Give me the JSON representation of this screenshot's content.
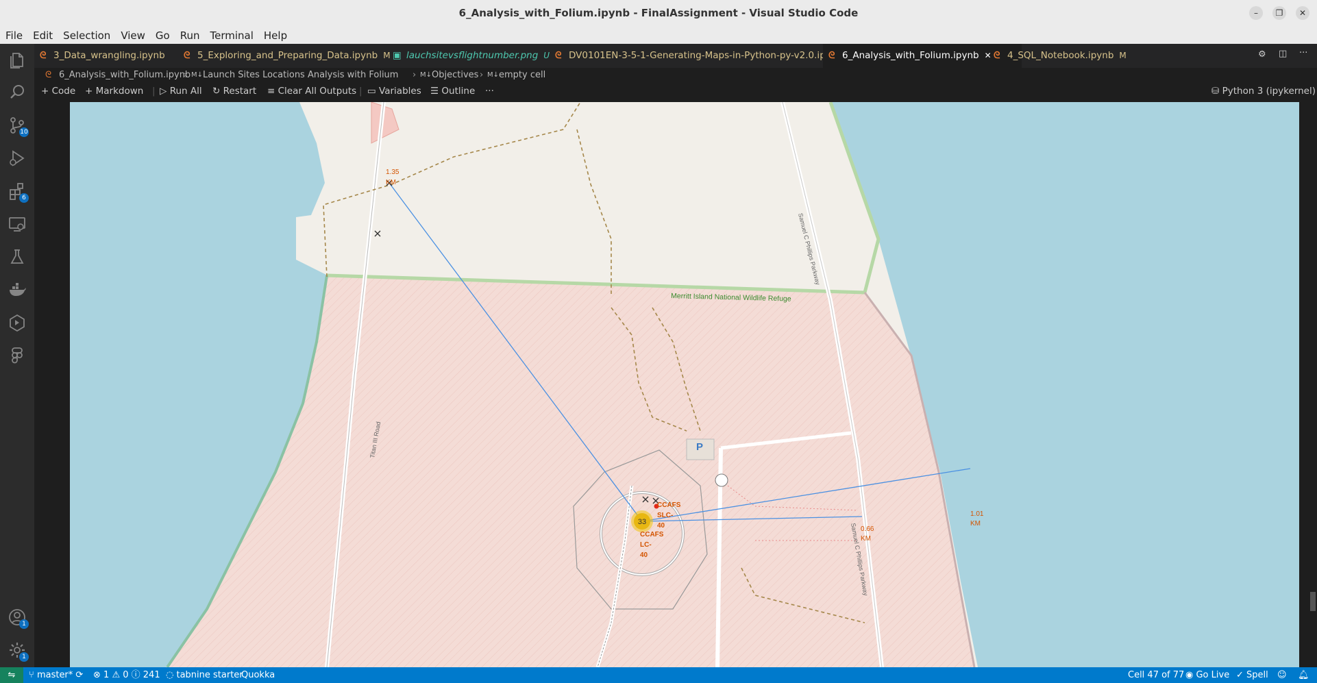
{
  "window": {
    "title": "6_Analysis_with_Folium.ipynb - FinalAssignment - Visual Studio Code",
    "minimize": "–",
    "restore": "❐",
    "close": "✕"
  },
  "menu": [
    "File",
    "Edit",
    "Selection",
    "View",
    "Go",
    "Run",
    "Terminal",
    "Help"
  ],
  "activity": {
    "scm_badge": "10",
    "extensions_badge": "6",
    "accounts_badge": "1",
    "settings_badge": "1"
  },
  "tabs": [
    {
      "label": "3_Data_wrangling.ipynb",
      "modified": ""
    },
    {
      "label": "5_Exploring_and_Preparing_Data.ipynb",
      "modified": "M"
    },
    {
      "label": "lauchsitevsflightnumber.png",
      "modified": "U"
    },
    {
      "label": "DV0101EN-3-5-1-Generating-Maps-in-Python-py-v2.0.ipynb",
      "modified": ""
    },
    {
      "label": "6_Analysis_with_Folium.ipynb",
      "modified": "✕"
    },
    {
      "label": "4_SQL_Notebook.ipynb",
      "modified": "M"
    }
  ],
  "breadcrumb": {
    "file": "6_Analysis_with_Folium.ipynb",
    "c1": "Launch Sites Locations Analysis with Folium",
    "c2": "Objectives",
    "c3": "empty cell",
    "md": "M↓"
  },
  "toolbar": {
    "code": "Code",
    "markdown": "Markdown",
    "run_all": "Run All",
    "restart": "Restart",
    "clear": "Clear All Outputs",
    "variables": "Variables",
    "outline": "Outline",
    "more": "···",
    "kernel": "Python 3 (ipykernel)"
  },
  "map": {
    "road1": "Titan III Road",
    "road2": "Samuel C Phillips Parkway",
    "road3": "Samuel C Phillips Parkway",
    "refuge": "Merritt Island National Wildlife Refuge",
    "cluster_count": "33",
    "site1": [
      "CCAFS",
      "SLC-",
      "40"
    ],
    "site2": [
      "CCAFS",
      "LC-",
      "40"
    ],
    "dist1": [
      "1.35",
      "KM"
    ],
    "dist2": [
      "0.66",
      "KM"
    ],
    "dist3": [
      "1.01",
      "KM"
    ],
    "parking": "P"
  },
  "status": {
    "branch": "master*",
    "errors": "1",
    "warnings": "0",
    "info": "241",
    "tabnine": "tabnine starter",
    "quokka": "Quokka",
    "cell": "Cell 47 of 77",
    "golive": "Go Live",
    "spell": "Spell"
  }
}
